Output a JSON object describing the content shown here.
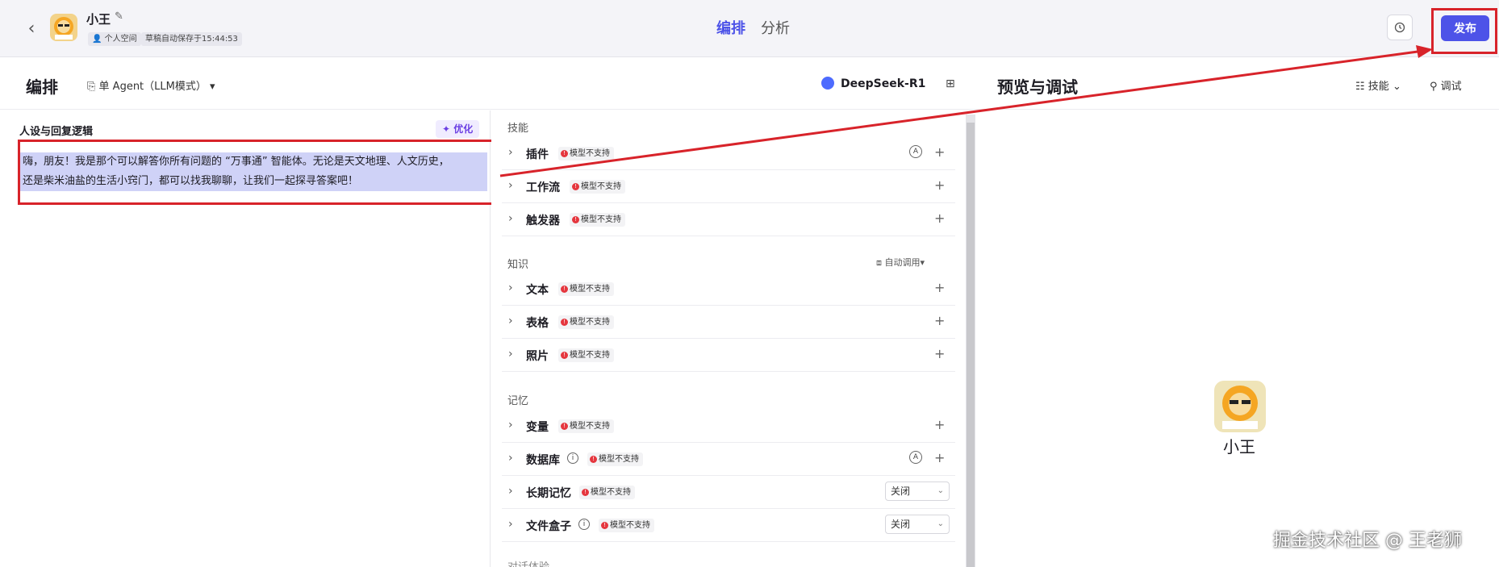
{
  "header": {
    "bot_name": "小王",
    "space_label": "个人空间",
    "autosave_label": "草稿自动保存于15:44:53",
    "tabs": [
      "编排",
      "分析"
    ],
    "publish_label": "发布"
  },
  "subbar": {
    "arrange_title": "编排",
    "agent_mode": "单 Agent（LLM模式）",
    "model_name": "DeepSeek-R1",
    "preview_title": "预览与调试",
    "skill_tab": "技能",
    "debug_tab": "调试"
  },
  "persona": {
    "title": "人设与回复逻辑",
    "optimize_label": "优化",
    "line1": "嗨，朋友！我是那个可以解答你所有问题的 “万事通” 智能体。无论是天文地理、人文历史，",
    "line2": "还是柴米油盐的生活小窍门，都可以找我聊聊，让我们一起探寻答案吧！"
  },
  "config": {
    "unsupported_label": "模型不支持",
    "groups": {
      "skills": "技能",
      "knowledge": "知识",
      "memory": "记忆",
      "dialog": "对话体验"
    },
    "auto_call_label": "自动调用",
    "items": {
      "plugin": "插件",
      "workflow": "工作流",
      "trigger": "触发器",
      "text": "文本",
      "table": "表格",
      "photo": "照片",
      "variable": "变量",
      "database": "数据库",
      "long_memory": "长期记忆",
      "file_box": "文件盒子"
    },
    "off_label": "关闭"
  },
  "preview": {
    "bot_name": "小王"
  },
  "watermark": "掘金技术社区 @ 王老狮",
  "colors": {
    "accent": "#4d53e8",
    "highlight": "#cfd2f7",
    "annotation": "#d8232a",
    "warning": "#e5363e"
  }
}
